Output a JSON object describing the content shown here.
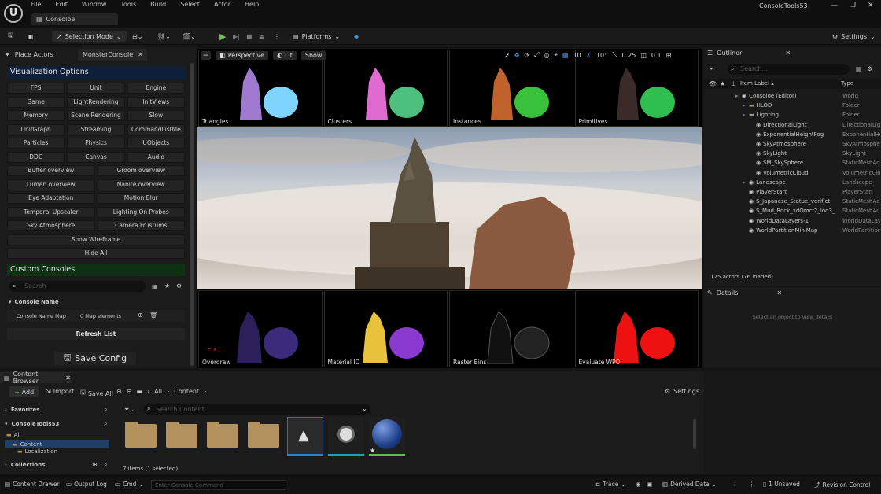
{
  "app": {
    "menu": [
      "File",
      "Edit",
      "Window",
      "Tools",
      "Build",
      "Select",
      "Actor",
      "Help"
    ],
    "doc_tab": "Consoloe",
    "project": "ConsoleTools53"
  },
  "toolbar": {
    "mode": "Selection Mode",
    "platforms": "Platforms",
    "settings": "Settings"
  },
  "left_tabs": {
    "place": "Place Actors",
    "monster": "MonsterConsole"
  },
  "visualization": {
    "title": "Visualization Options",
    "buttons": [
      "FPS",
      "Unit",
      "Engine",
      "Game",
      "LightRendering",
      "InitViews",
      "Memory",
      "Scene Rendering",
      "Slow",
      "UnitGraph",
      "Streaming",
      "CommandListMe",
      "Particles",
      "Physics",
      "UObjects",
      "DDC",
      "Canvas",
      "Audio",
      "Buffer overview",
      "Groom overview",
      "Lumen overview",
      "Nanite overview",
      "Eye Adaptation",
      "Motion Blur",
      "Temporal Upscaler",
      "Lighting On Probes",
      "Sky Atmosphere",
      "Camera Frustums",
      "Show WireFrame",
      "Hide All"
    ]
  },
  "custom": {
    "title": "Custom Consoles",
    "search_placeholder": "Search",
    "col_header": "Console Name",
    "map_label": "Console Name Map",
    "map_value": "0 Map elements",
    "refresh": "Refresh List",
    "save": "Save Config"
  },
  "viewport": {
    "perspective": "Perspective",
    "lit": "Lit",
    "show": "Show",
    "grid": "10",
    "angle": "10°",
    "scale": "0.25",
    "speed": "0.1",
    "top_thumbs": [
      "Triangles",
      "Clusters",
      "Instances",
      "Primitives"
    ],
    "bottom_thumbs": [
      "Overdraw",
      "Material ID",
      "Raster Bins",
      "Evaluate WPO"
    ]
  },
  "outliner": {
    "title": "Outliner",
    "search_placeholder": "Search...",
    "col_label": "Item Label ▴",
    "col_type": "Type",
    "rows": [
      {
        "label": "Consoloe (Editor)",
        "type": "World",
        "indent": 0
      },
      {
        "label": "HLOD",
        "type": "Folder",
        "indent": 1
      },
      {
        "label": "Lighting",
        "type": "Folder",
        "indent": 1
      },
      {
        "label": "DirectionalLight",
        "type": "DirectionalLig",
        "indent": 2
      },
      {
        "label": "ExponentialHeightFog",
        "type": "ExponentialHe",
        "indent": 2
      },
      {
        "label": "SkyAtmosphere",
        "type": "SkyAtmosphe",
        "indent": 2
      },
      {
        "label": "SkyLight",
        "type": "SkyLight",
        "indent": 2
      },
      {
        "label": "SM_SkySphere",
        "type": "StaticMeshAc",
        "indent": 2
      },
      {
        "label": "VolumetricCloud",
        "type": "VolumetricClo",
        "indent": 2
      },
      {
        "label": "Landscape",
        "type": "Landscape",
        "indent": 1
      },
      {
        "label": "PlayerStart",
        "type": "PlayerStart",
        "indent": 1
      },
      {
        "label": "S_Japanese_Statue_verifjct",
        "type": "StaticMeshAc",
        "indent": 1
      },
      {
        "label": "S_Mud_Rock_xdOmcf2_lod3_",
        "type": "StaticMeshAc",
        "indent": 1
      },
      {
        "label": "WorldDataLayers-1",
        "type": "WorldDataLay",
        "indent": 1
      },
      {
        "label": "WorldPartitionMiniMap",
        "type": "WorldPartition",
        "indent": 1
      }
    ],
    "count": "125 actors (76 loaded)"
  },
  "details": {
    "title": "Details",
    "empty": "Select an object to view details"
  },
  "content_browser": {
    "title": "Content Browser",
    "add": "Add",
    "import": "Import",
    "save_all": "Save All",
    "crumb_all": "All",
    "crumb_content": "Content",
    "settings": "Settings",
    "favorites": "Favorites",
    "project": "ConsoleTools53",
    "tree": [
      "All",
      "Content",
      "Localization"
    ],
    "collections": "Collections",
    "search_placeholder": "Search Content",
    "status": "7 items (1 selected)"
  },
  "statusbar": {
    "drawer": "Content Drawer",
    "output": "Output Log",
    "cmd": "Cmd",
    "cmd_placeholder": "Enter Console Command",
    "trace": "Trace",
    "derived": "Derived Data",
    "unsaved": "1 Unsaved",
    "revision": "Revision Control"
  }
}
